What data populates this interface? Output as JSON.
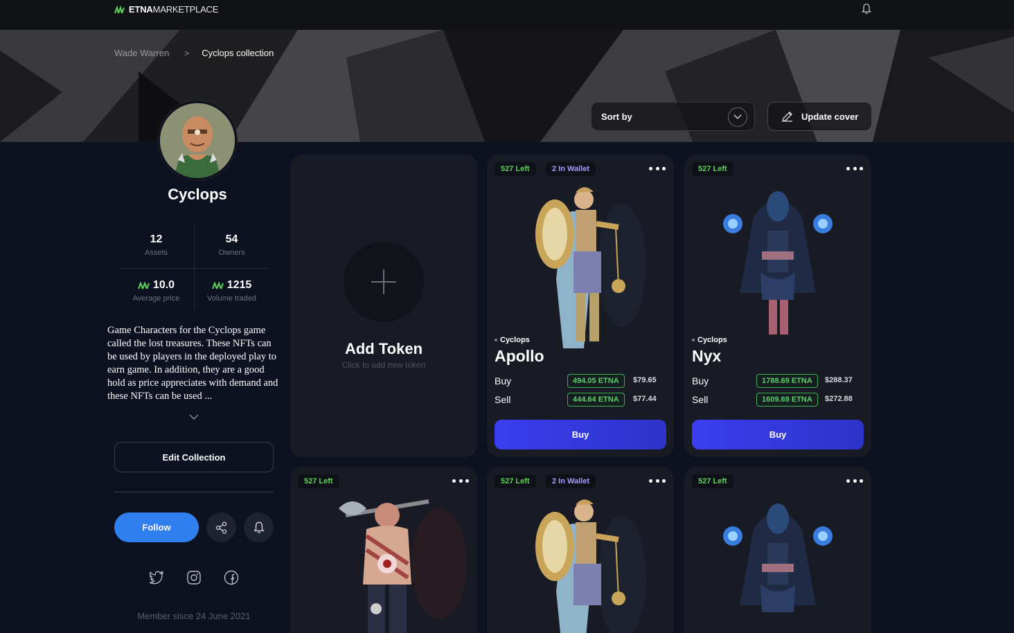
{
  "header": {
    "brand_strong": "ETNA",
    "brand_light": "MARKETPLACE",
    "logo_icon": "etna-logo-icon",
    "bell_icon": "bell-icon"
  },
  "breadcrumb": {
    "items": [
      "Wade Warren",
      "Cyclops collection"
    ],
    "separator": ">"
  },
  "cover_controls": {
    "sort_label": "Sort by",
    "update_cover_label": "Update cover"
  },
  "profile": {
    "name": "Cyclops",
    "stats": [
      {
        "value": "12",
        "label": "Assets"
      },
      {
        "value": "54",
        "label": "Owners"
      },
      {
        "value": "10.0",
        "label": "Average price"
      },
      {
        "value": "1215",
        "label": "Volume traded"
      }
    ],
    "description": "Game Characters for the Cyclops game called the lost treasures. These NFTs can be used by players in the deployed play to earn game. In addition, they are a good hold as price appreciates with demand and these NFTs can be used ...",
    "edit_label": "Edit Collection",
    "follow_label": "Follow",
    "member_since": "Member sisce 24 June 2021"
  },
  "add_token": {
    "title": "Add Token",
    "subtitle": "Click to add new token"
  },
  "cards": [
    {
      "left_badge": "527 Left",
      "wallet_badge": "2 In Wallet",
      "collection": "Cyclops",
      "name": "Apollo",
      "buy_label": "Buy",
      "sell_label": "Sell",
      "buy_etna": "494.05 ETNA",
      "buy_usd": "$79.65",
      "sell_etna": "444.64 ETNA",
      "sell_usd": "$77.44",
      "button_label": "Buy"
    },
    {
      "left_badge": "527 Left",
      "collection": "Cyclops",
      "name": "Nyx",
      "buy_label": "Buy",
      "sell_label": "Sell",
      "buy_etna": "1788.69 ETNA",
      "buy_usd": "$288.37",
      "sell_etna": "1609.69 ETNA",
      "sell_usd": "$272.88",
      "button_label": "Buy"
    },
    {
      "left_badge": "527 Left"
    },
    {
      "left_badge": "527 Left",
      "wallet_badge": "2 In Wallet"
    },
    {
      "left_badge": "527 Left"
    }
  ],
  "colors": {
    "background": "#0d1120",
    "accent_blue": "#2f7ff0",
    "buy_button": "#3b3ef0",
    "price_green": "#5ad06a",
    "etna_green": "#5fd35a"
  }
}
